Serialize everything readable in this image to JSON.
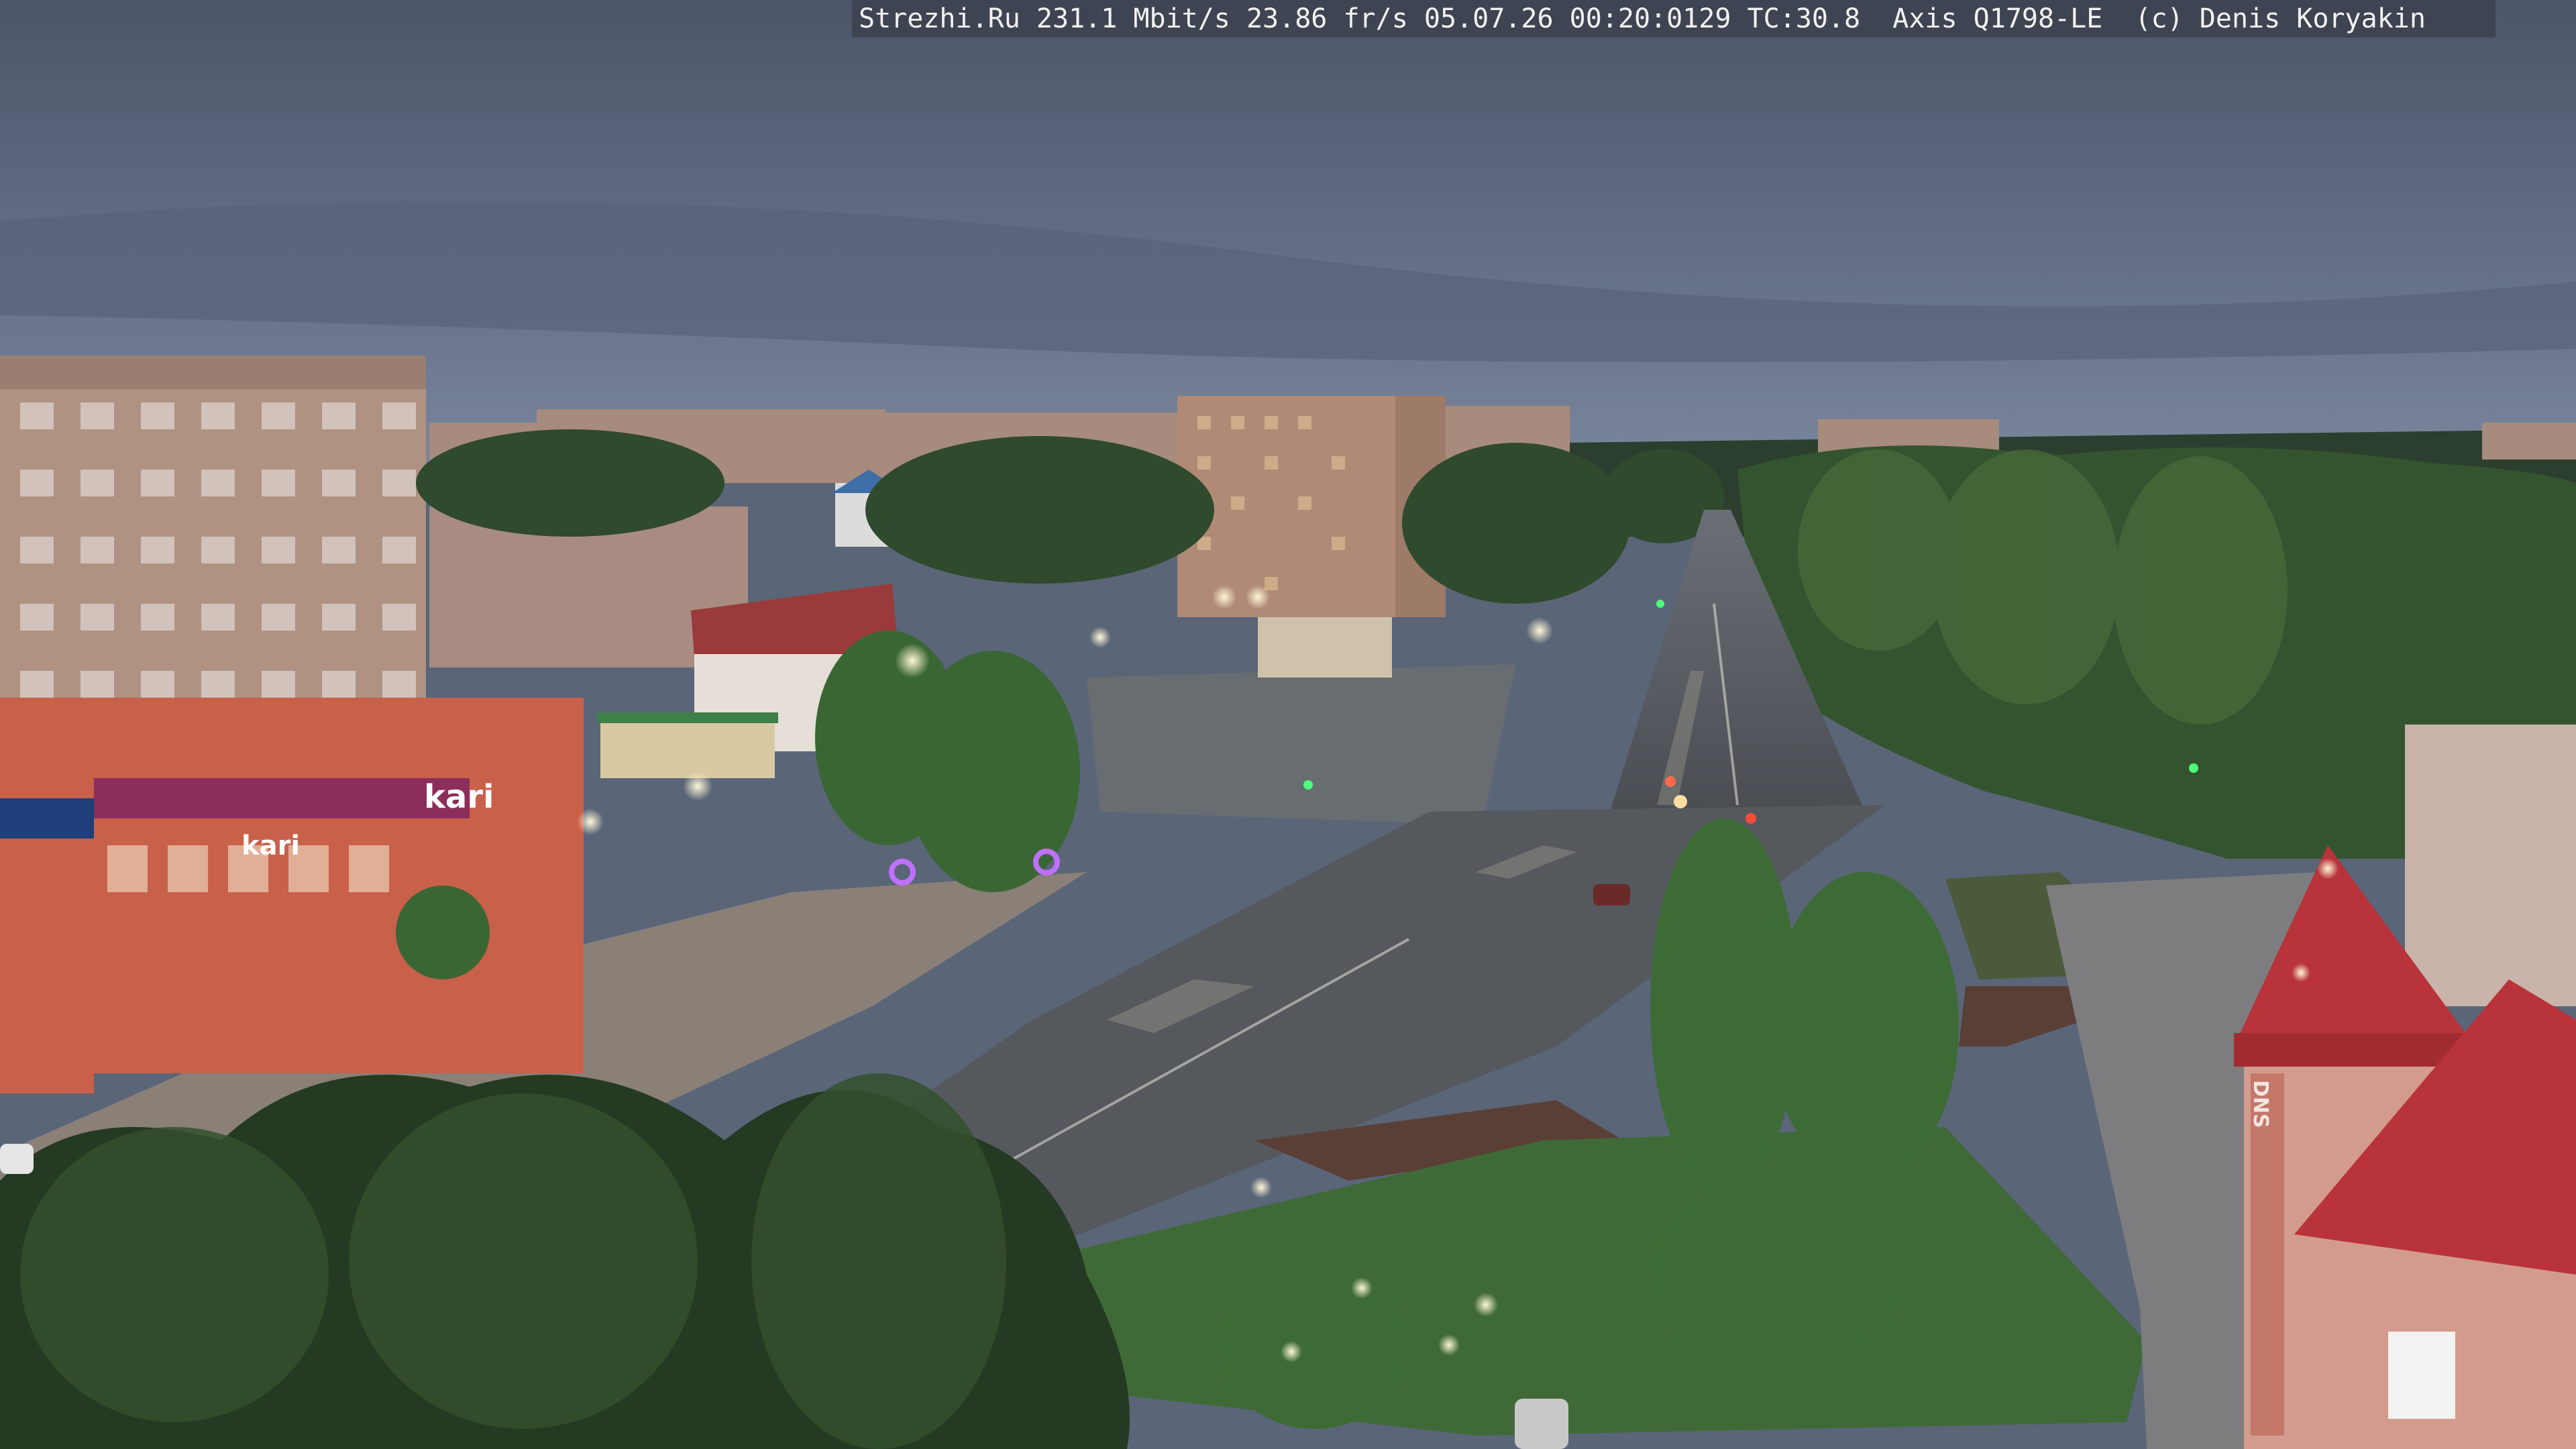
{
  "camera_overlay": {
    "caption": "Strezhi.Ru 231.1 Mbit/s 23.86 fr/s 05.07.26 00:20:0129 TC:30.8  Axis Q1798-LE  (c) Denis Koryakin"
  },
  "signs": {
    "kari_roof": "kari",
    "kari_front": "kari",
    "dns": "DNS"
  },
  "colors": {
    "sky": "#5a6578",
    "overlay_bg": "#3f4452",
    "tree": "#2f4a2c",
    "road": "#4e5356",
    "store_facade": "#c9604a",
    "roof_red": "#b8333a"
  }
}
